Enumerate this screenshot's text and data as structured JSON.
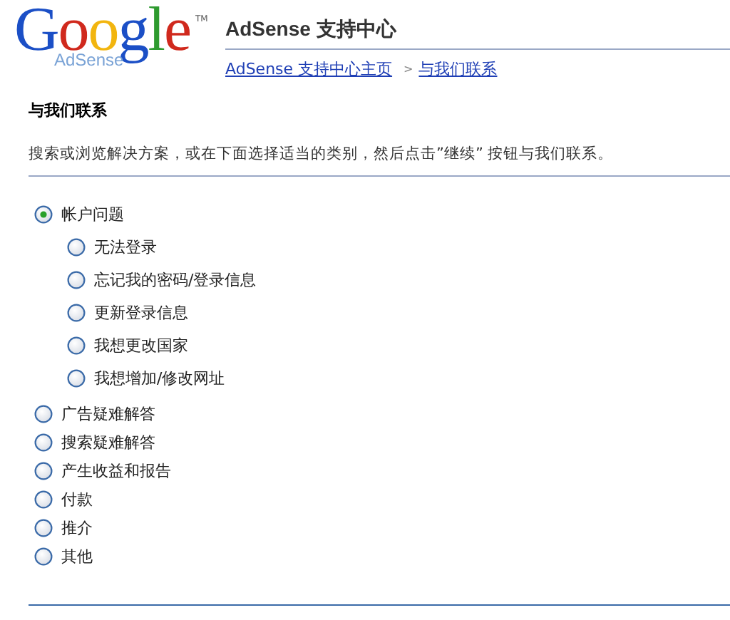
{
  "logo": {
    "wordmark": "Google",
    "trademark": "TM",
    "product": "AdSense"
  },
  "header": {
    "title": "AdSense 支持中心",
    "breadcrumbs": [
      {
        "label": "AdSense 支持中心主页"
      },
      {
        "separator": ">",
        "label": "与我们联系"
      }
    ]
  },
  "heading": "与我们联系",
  "description": "搜索或浏览解决方案，或在下面选择适当的类别，然后点击”继续” 按钮与我们联系。",
  "options": [
    {
      "label": "帐户问题",
      "selected": true,
      "children": [
        {
          "label": "无法登录",
          "selected": false
        },
        {
          "label": "忘记我的密码/登录信息",
          "selected": false
        },
        {
          "label": "更新登录信息",
          "selected": false
        },
        {
          "label": "我想更改国家",
          "selected": false
        },
        {
          "label": "我想增加/修改网址",
          "selected": false
        }
      ]
    },
    {
      "label": "广告疑难解答",
      "selected": false
    },
    {
      "label": "搜索疑难解答",
      "selected": false
    },
    {
      "label": "产生收益和报告",
      "selected": false
    },
    {
      "label": "付款",
      "selected": false
    },
    {
      "label": "推介",
      "selected": false
    },
    {
      "label": "其他",
      "selected": false
    }
  ]
}
